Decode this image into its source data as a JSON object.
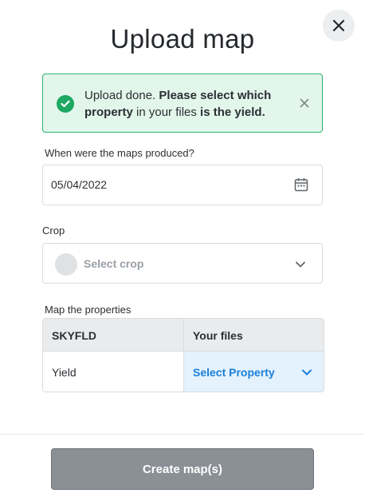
{
  "modal": {
    "title": "Upload map",
    "close_icon": "close-icon"
  },
  "alert": {
    "icon": "check-circle-icon",
    "text_plain_1": "Upload done. ",
    "text_bold_1": "Please select which property",
    "text_plain_2": " in your files ",
    "text_bold_2": "is the yield.",
    "dismiss_icon": "close-icon",
    "border_color": "#2bb36a",
    "background": "#e3f6ec"
  },
  "date_field": {
    "label": "When were the maps produced?",
    "value": "05/04/2022",
    "icon": "calendar-icon"
  },
  "crop_field": {
    "label": "Crop",
    "placeholder": "Select crop",
    "icon": "chevron-down-icon"
  },
  "mapping": {
    "label": "Map the properties",
    "headers": [
      "SKYFLD",
      "Your files"
    ],
    "rows": [
      {
        "property": "Yield",
        "selection": "Select Property"
      }
    ],
    "accent": "#1a7fd8"
  },
  "footer": {
    "create_label": "Create map(s)"
  }
}
